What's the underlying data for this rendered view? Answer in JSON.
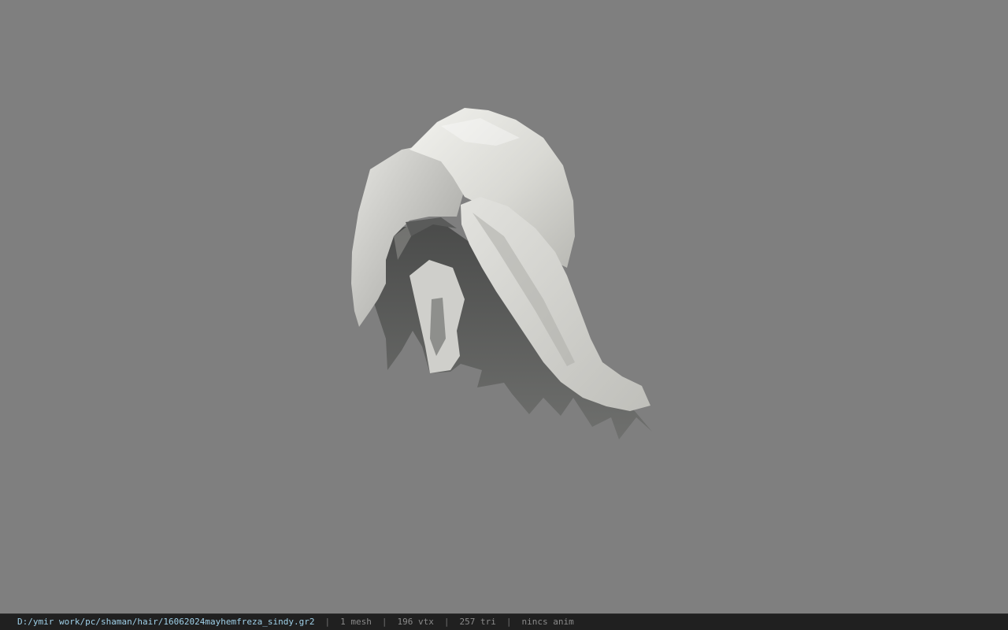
{
  "viewport": {
    "background_color": "#7f7f7f",
    "model_name": "hair-mesh"
  },
  "statusbar": {
    "file_path": "D:/ymir work/pc/shaman/hair/16062024mayhemfreza_sindy.gr2",
    "separator": "|",
    "mesh_count": "1 mesh",
    "vertex_count": "196 vtx",
    "triangle_count": "257 tri",
    "anim_status": "nincs anim",
    "path_color": "#9fd0e8",
    "text_color": "#8a8a8a"
  }
}
